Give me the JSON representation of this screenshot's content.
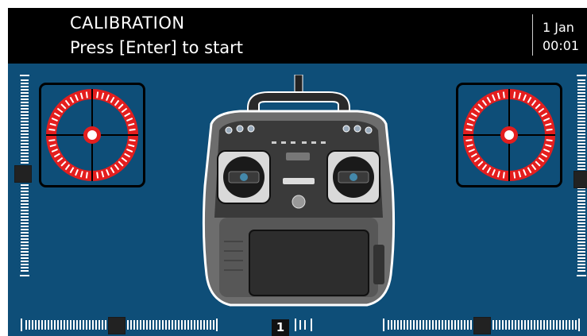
{
  "header": {
    "title": "CALIBRATION",
    "subtitle": "Press [Enter] to start",
    "date": "1 Jan",
    "time": "00:01"
  },
  "left_gimbal": {
    "x": 0,
    "y": 0
  },
  "right_gimbal": {
    "x": 0,
    "y": 0
  },
  "trims": {
    "left_vertical": 0,
    "right_vertical": 0,
    "left_horizontal": 0,
    "right_horizontal": 0
  },
  "bottom": {
    "center_number": "1"
  },
  "colors": {
    "background": "#0e4e78",
    "header": "#000000",
    "gimbal_ring": "#e41e1e",
    "tick": "#ffffff"
  },
  "icons": [
    "radio-transmitter-image"
  ]
}
